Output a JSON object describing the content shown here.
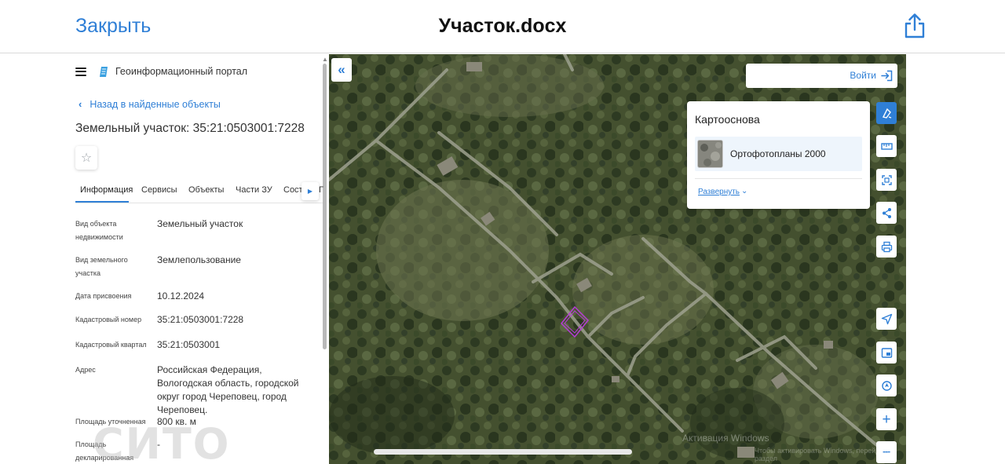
{
  "topbar": {
    "close_label": "Закрыть",
    "doc_title": "Участок.docx",
    "share_icon": "share-icon"
  },
  "panel": {
    "portal_name": "Геоинформационный портал",
    "back_label": "Назад в найденные объекты",
    "title": "Земельный участок: 35:21:0503001:7228",
    "tabs": [
      {
        "label": "Информация",
        "active": true
      },
      {
        "label": "Сервисы",
        "active": false
      },
      {
        "label": "Объекты",
        "active": false
      },
      {
        "label": "Части ЗУ",
        "active": false
      },
      {
        "label": "Соста",
        "active": false
      },
      {
        "label": "Г",
        "active": false
      }
    ],
    "rows": [
      {
        "label": "Вид объекта недвижимости",
        "value": "Земельный участок"
      },
      {
        "label": "Вид земельного участка",
        "value": "Землепользование"
      },
      {
        "label": "Дата присвоения",
        "value": "10.12.2024"
      },
      {
        "label": "Кадастровый номер",
        "value": "35:21:0503001:7228"
      },
      {
        "label": "Кадастровый квартал",
        "value": "35:21:0503001"
      },
      {
        "label": "Адрес",
        "value": "Российская Федерация, Вологодская область, городской округ город Череповец, город Череповец."
      },
      {
        "label": "Площадь уточненная",
        "value": "800 кв. м"
      },
      {
        "label": "Площадь декларированная",
        "value": "-"
      }
    ],
    "watermark": "СИТО"
  },
  "map": {
    "login_label": "Войти",
    "basemap": {
      "title": "Картооснова",
      "item_label": "Ортофотопланы 2000",
      "expand_label": "Развернуть"
    },
    "windows_activation": "Активация Windows",
    "windows_activation_hint": "Чтобы активировать Windows, перейдите в раздел",
    "tools": [
      "layers-icon",
      "ruler-icon",
      "select-area-icon",
      "share-icon",
      "print-icon",
      "locate-icon",
      "minimap-icon",
      "geolocation-icon",
      "zoom-in-icon",
      "zoom-out-icon"
    ]
  },
  "colors": {
    "accent": "#2f7fd6",
    "parcel_outline": "#b63bd6"
  }
}
